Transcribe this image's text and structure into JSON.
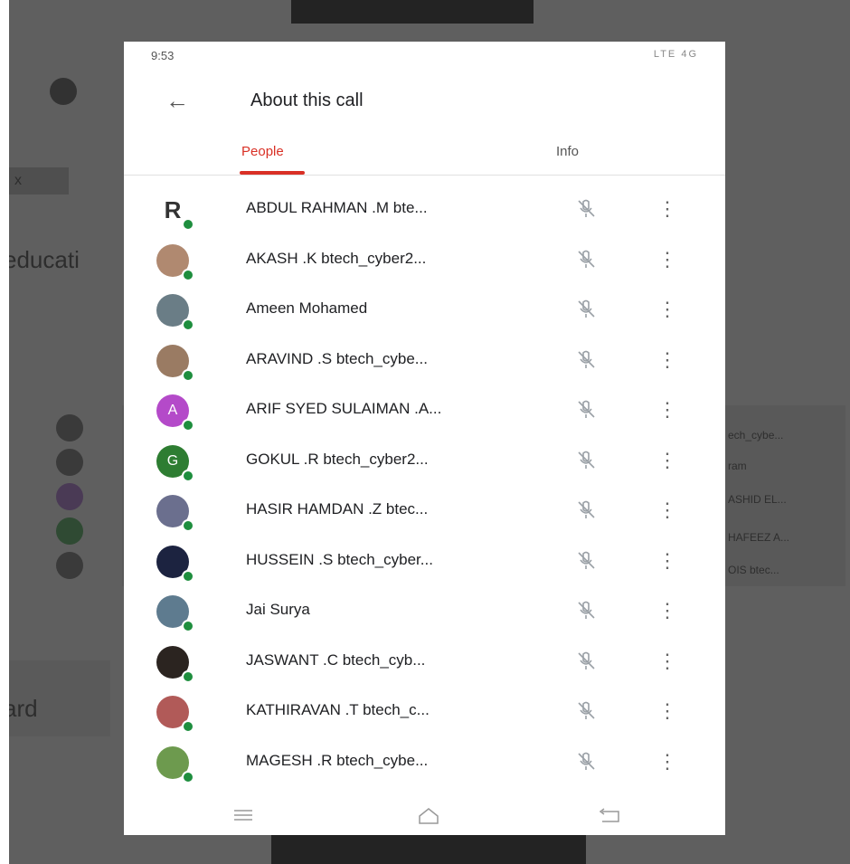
{
  "background": {
    "education_text": "educati",
    "card_text": "ard",
    "chip_text": "x",
    "right_list": [
      "ech_cybe...",
      "ram",
      "ASHID EL...",
      "HAFEEZ A...",
      "OIS btec..."
    ]
  },
  "status": {
    "time": "9:53",
    "icons": "LTE 4G"
  },
  "appbar": {
    "back_glyph": "←",
    "title": "About this call"
  },
  "tabs": {
    "people": "People",
    "info": "Info"
  },
  "participants": [
    {
      "name": "ABDUL RAHMAN .M bte...",
      "avatar_text": "R",
      "avatar_color": "#ffffff",
      "text_color": "#333333"
    },
    {
      "name": "AKASH .K btech_cyber2...",
      "avatar_text": "",
      "avatar_color": "#b08970"
    },
    {
      "name": "Ameen Mohamed",
      "avatar_text": "",
      "avatar_color": "#6a7d86"
    },
    {
      "name": "ARAVIND .S btech_cybe...",
      "avatar_text": "",
      "avatar_color": "#9a7b63"
    },
    {
      "name": "ARIF SYED SULAIMAN .A...",
      "avatar_text": "A",
      "avatar_color": "#b44ac9"
    },
    {
      "name": "GOKUL .R btech_cyber2...",
      "avatar_text": "G",
      "avatar_color": "#2e7d32"
    },
    {
      "name": "HASIR HAMDAN .Z btec...",
      "avatar_text": "",
      "avatar_color": "#6b6f8e"
    },
    {
      "name": "HUSSEIN .S btech_cyber...",
      "avatar_text": "",
      "avatar_color": "#1c2340"
    },
    {
      "name": "Jai Surya",
      "avatar_text": "",
      "avatar_color": "#5e7b8f"
    },
    {
      "name": "JASWANT .C btech_cyb...",
      "avatar_text": "",
      "avatar_color": "#2b2420"
    },
    {
      "name": "KATHIRAVAN .T btech_c...",
      "avatar_text": "",
      "avatar_color": "#b15a58"
    },
    {
      "name": "MAGESH .R btech_cybe...",
      "avatar_text": "",
      "avatar_color": "#6d9a4e"
    }
  ],
  "icons": {
    "mic": "mic-off-icon",
    "more": "more-vert-icon"
  },
  "navbar": [
    "menu-icon",
    "home-icon",
    "back-icon"
  ]
}
